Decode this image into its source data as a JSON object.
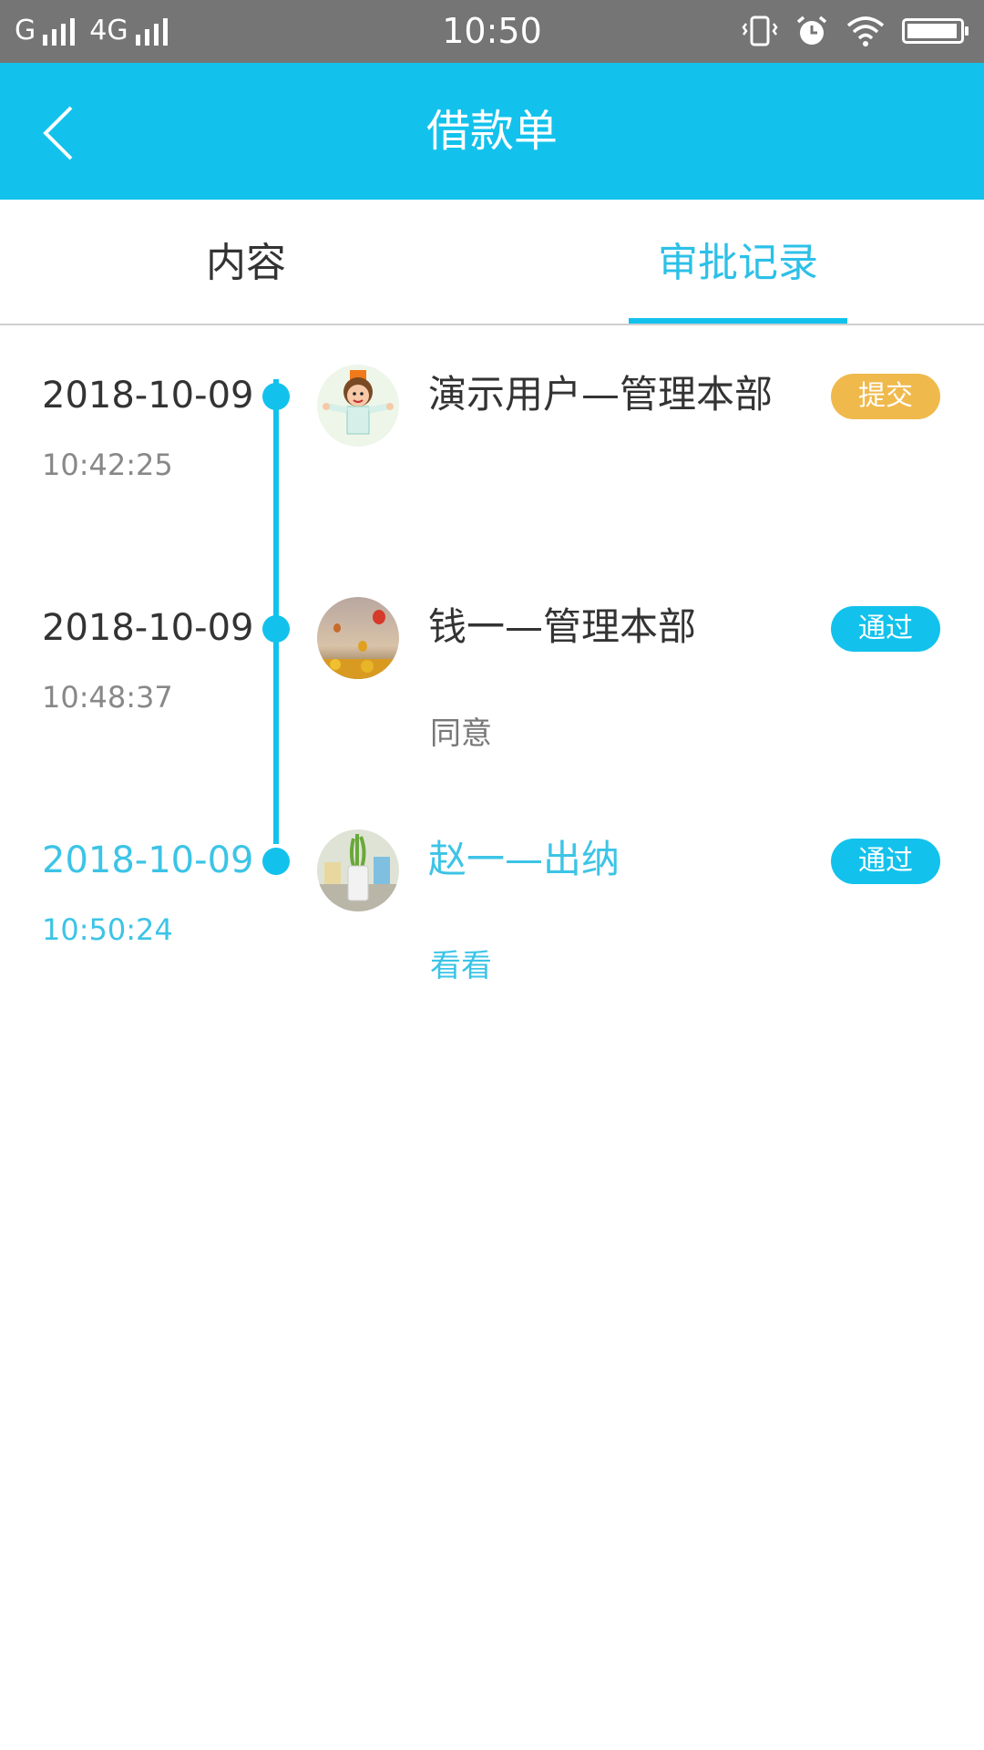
{
  "status_bar": {
    "carrier1": "G",
    "carrier2": "4G",
    "time": "10:50"
  },
  "header": {
    "title": "借款单"
  },
  "tabs": [
    {
      "label": "内容",
      "active": false
    },
    {
      "label": "审批记录",
      "active": true
    }
  ],
  "colors": {
    "accent": "#12c2ec",
    "submit_badge": "#f0b94c",
    "pass_badge": "#12c2ec"
  },
  "records": [
    {
      "date": "2018-10-09",
      "time": "10:42:25",
      "name": "演示用户—管理本部",
      "status": "提交",
      "comment": "",
      "avatar": "cartoon-boy-avatar"
    },
    {
      "date": "2018-10-09",
      "time": "10:48:37",
      "name": "钱一—管理本部",
      "status": "通过",
      "comment": "同意",
      "avatar": "balloons-sky-avatar"
    },
    {
      "date": "2018-10-09",
      "time": "10:50:24",
      "name": "赵一—出纳",
      "status": "通过",
      "comment": "看看",
      "avatar": "plant-vase-avatar"
    }
  ]
}
